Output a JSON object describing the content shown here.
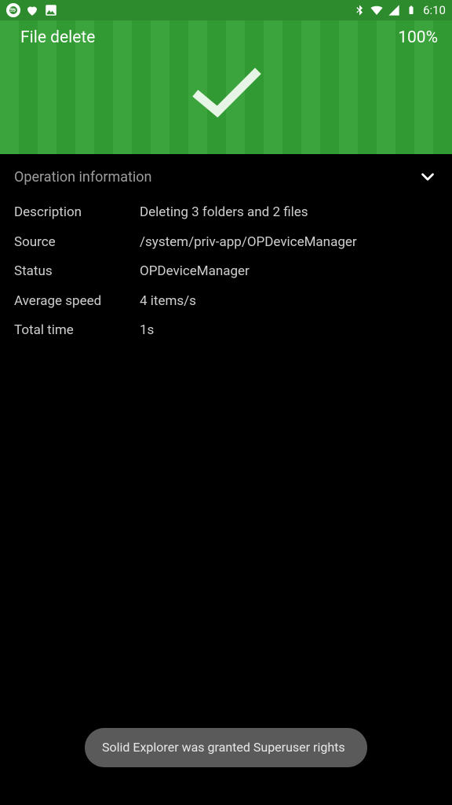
{
  "status_bar": {
    "clock": "6:10"
  },
  "header": {
    "title": "File delete",
    "progress": "100%"
  },
  "section": {
    "title": "Operation information"
  },
  "info": {
    "rows": [
      {
        "label": "Description",
        "value": "Deleting 3 folders and 2 files"
      },
      {
        "label": "Source",
        "value": "/system/priv-app/OPDeviceManager"
      },
      {
        "label": "Status",
        "value": "OPDeviceManager"
      },
      {
        "label": "Average speed",
        "value": "4 items/s"
      },
      {
        "label": "Total time",
        "value": "1s"
      }
    ]
  },
  "toast": {
    "message": "Solid Explorer was granted Superuser rights"
  }
}
